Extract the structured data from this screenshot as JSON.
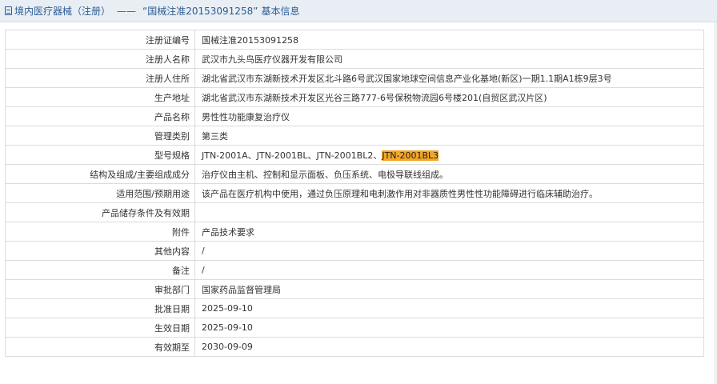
{
  "header": {
    "category": "境内医疗器械（注册）",
    "separator": "——",
    "title": "“国械注准20153091258”",
    "title_suffix": "基本信息"
  },
  "rows": [
    {
      "label": "注册证编号",
      "value": "国械注准20153091258"
    },
    {
      "label": "注册人名称",
      "value": "武汉市九头鸟医疗仪器开发有限公司"
    },
    {
      "label": "注册人住所",
      "value": "湖北省武汉市东湖新技术开发区北斗路6号武汉国家地球空间信息产业化基地(新区)一期1.1期A1栋9层3号"
    },
    {
      "label": "生产地址",
      "value": "湖北省武汉市东湖新技术开发区光谷三路777-6号保税物流园6号楼201(自贸区武汉片区)"
    },
    {
      "label": "产品名称",
      "value": "男性性功能康复治疗仪"
    },
    {
      "label": "管理类别",
      "value": "第三类"
    },
    {
      "label": "型号规格",
      "value": "JTN-2001A、JTN-2001BL、JTN-2001BL2、",
      "highlight": "JTN-2001BL3"
    },
    {
      "label": "结构及组成/主要组成成分",
      "value": "治疗仪由主机、控制和显示面板、负压系统、电极导联线组成。"
    },
    {
      "label": "适用范围/预期用途",
      "value": "该产品在医疗机构中使用，通过负压原理和电刺激作用对非器质性男性性功能障碍进行临床辅助治疗。"
    },
    {
      "label": "产品储存条件及有效期",
      "value": ""
    },
    {
      "label": "附件",
      "value": "产品技术要求"
    },
    {
      "label": "其他内容",
      "value": "/"
    },
    {
      "label": "备注",
      "value": "/"
    },
    {
      "label": "审批部门",
      "value": "国家药品监督管理局"
    },
    {
      "label": "批准日期",
      "value": "2025-09-10"
    },
    {
      "label": "生效日期",
      "value": "2025-09-10"
    },
    {
      "label": "有效期至",
      "value": "2030-09-09"
    }
  ],
  "colors": {
    "header_bg": "#e9eef4",
    "header_text": "#2c5c93",
    "highlight": "#f5a623"
  },
  "icons": {
    "header": "document-icon"
  }
}
